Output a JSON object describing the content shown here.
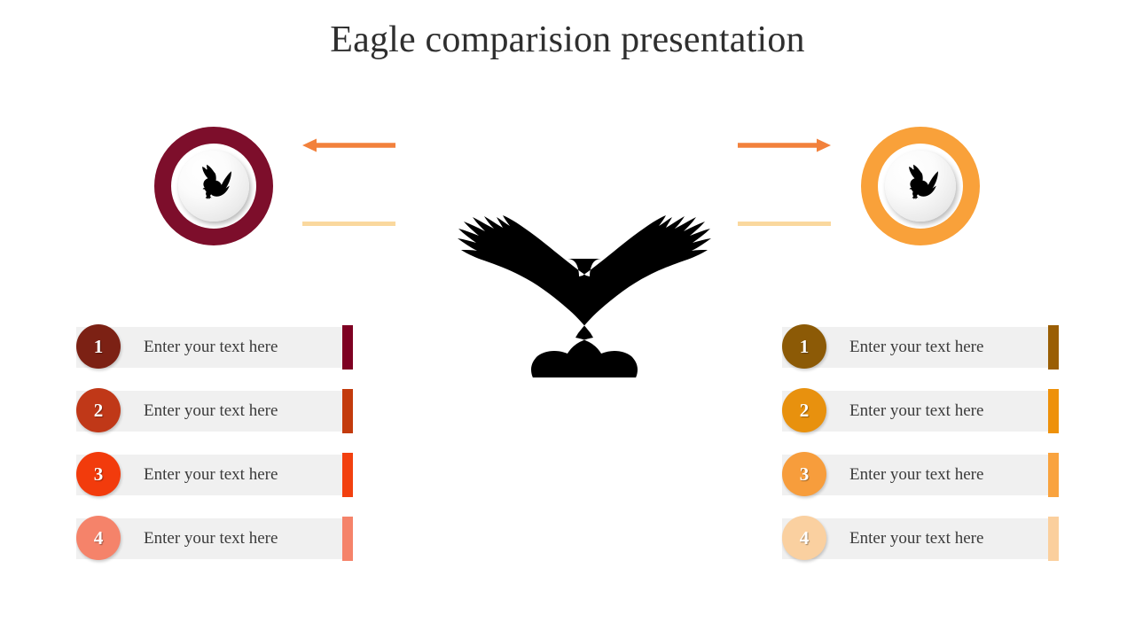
{
  "slide": {
    "title": "Eagle comparision presentation",
    "background": "#ffffff",
    "title_color": "#2f2f2f"
  },
  "badges": {
    "left": {
      "name": "left-eagle-badge",
      "ring_color": "#7d0e2b",
      "inner_icon": "eagle-icon"
    },
    "right": {
      "name": "right-eagle-badge",
      "ring_color": "#f9a13a",
      "inner_icon": "eagle-icon"
    }
  },
  "connectors": {
    "left_arrow": {
      "icon": "arrow-left-icon",
      "color": "#f2813c"
    },
    "right_arrow": {
      "icon": "arrow-right-icon",
      "color": "#f2813c"
    },
    "left_line": {
      "color": "#fad89e"
    },
    "right_line": {
      "color": "#fad89e"
    }
  },
  "center": {
    "icon": "eagle-silhouette-icon",
    "color": "#000000"
  },
  "left_column": {
    "rows": [
      {
        "number": "1",
        "text": "Enter your text here",
        "circle_color": "#7c2114",
        "cap_color": "#7e0022"
      },
      {
        "number": "2",
        "text": "Enter your text here",
        "circle_color": "#c03818",
        "cap_color": "#c33b0d"
      },
      {
        "number": "3",
        "text": "Enter your text here",
        "circle_color": "#f23b0c",
        "cap_color": "#f2400f"
      },
      {
        "number": "4",
        "text": "Enter your text here",
        "circle_color": "#f5836a",
        "cap_color": "#f5836a"
      }
    ],
    "bar_color": "#f0f0f0"
  },
  "right_column": {
    "rows": [
      {
        "number": "1",
        "text": "Enter your text here",
        "circle_color": "#8c5a06",
        "cap_color": "#9a5e04"
      },
      {
        "number": "2",
        "text": "Enter your text here",
        "circle_color": "#e8910e",
        "cap_color": "#ee910a"
      },
      {
        "number": "3",
        "text": "Enter your text here",
        "circle_color": "#f79d3c",
        "cap_color": "#f9a33f"
      },
      {
        "number": "4",
        "text": "Enter your text here",
        "circle_color": "#fad0a0",
        "cap_color": "#fbcf9d"
      }
    ],
    "bar_color": "#f0f0f0"
  }
}
